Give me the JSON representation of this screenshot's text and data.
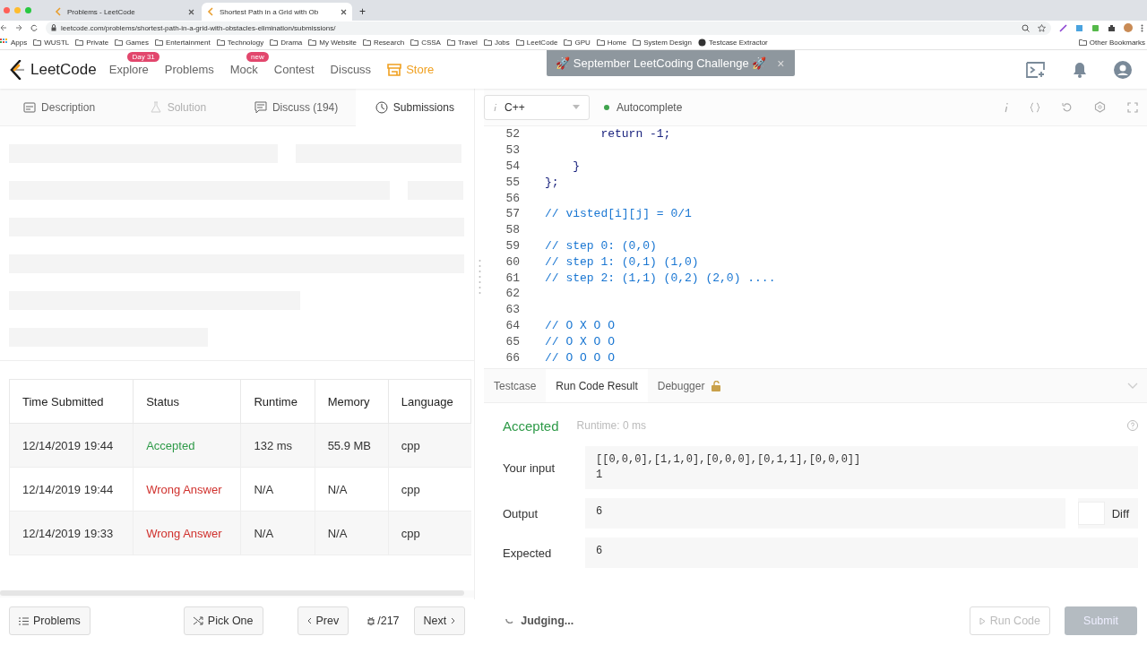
{
  "browser": {
    "tabs": [
      {
        "title": "Problems - LeetCode",
        "selected": false
      },
      {
        "title": "Shortest Path in a Grid with Ob",
        "selected": true
      }
    ],
    "new_tab": "+",
    "url": "leetcode.com/problems/shortest-path-in-a-grid-with-obstacles-elimination/submissions/",
    "bookmarks": [
      "Apps",
      "WUSTL",
      "Private",
      "Games",
      "Entertainment",
      "Technology",
      "Drama",
      "My Website",
      "Research",
      "CSSA",
      "Travel",
      "Jobs",
      "LeetCode",
      "GPU",
      "Home",
      "System Design",
      "Testcase Extractor"
    ],
    "other_bookmarks": "Other Bookmarks"
  },
  "nav": {
    "logo": "LeetCode",
    "items": [
      {
        "label": "Explore",
        "badge": "Day 31"
      },
      {
        "label": "Problems"
      },
      {
        "label": "Mock",
        "badge": "new"
      },
      {
        "label": "Contest"
      },
      {
        "label": "Discuss"
      },
      {
        "label": "Store",
        "kind": "store"
      }
    ],
    "banner": "🚀 September LeetCoding Challenge 🚀",
    "banner_close": "×"
  },
  "left_tabs": [
    {
      "label": "Description",
      "selected": false,
      "disabled": false
    },
    {
      "label": "Solution",
      "selected": false,
      "disabled": true
    },
    {
      "label": "Discuss (194)",
      "selected": false,
      "disabled": false
    },
    {
      "label": "Submissions",
      "selected": true,
      "disabled": false
    }
  ],
  "submissions": {
    "columns": [
      "Time Submitted",
      "Status",
      "Runtime",
      "Memory",
      "Language"
    ],
    "rows": [
      {
        "time": "12/14/2019 19:44",
        "status": "Accepted",
        "kind": "accepted",
        "runtime": "132 ms",
        "memory": "55.9 MB",
        "language": "cpp"
      },
      {
        "time": "12/14/2019 19:44",
        "status": "Wrong Answer",
        "kind": "wrong",
        "runtime": "N/A",
        "memory": "N/A",
        "language": "cpp"
      },
      {
        "time": "12/14/2019 19:33",
        "status": "Wrong Answer",
        "kind": "wrong",
        "runtime": "N/A",
        "memory": "N/A",
        "language": "cpp"
      }
    ]
  },
  "editor": {
    "language": "C++",
    "autocomplete": "Autocomplete",
    "lines": [
      {
        "n": "52",
        "code": "        return -1;",
        "kind": "code"
      },
      {
        "n": "53",
        "kind": "code"
      },
      {
        "n": "54",
        "code": "    }",
        "kind": "code"
      },
      {
        "n": "55",
        "code": "};",
        "kind": "code"
      },
      {
        "n": "56",
        "kind": "code"
      },
      {
        "n": "57",
        "code": "// visted[i][j] = 0/1",
        "kind": "comment"
      },
      {
        "n": "58",
        "kind": "code"
      },
      {
        "n": "59",
        "code": "// step 0: (0,0)",
        "kind": "comment"
      },
      {
        "n": "60",
        "code": "// step 1: (0,1) (1,0)",
        "kind": "comment"
      },
      {
        "n": "61",
        "code": "// step 2: (1,1) (0,2) (2,0) ....",
        "kind": "comment"
      },
      {
        "n": "62",
        "kind": "code"
      },
      {
        "n": "63",
        "kind": "code"
      },
      {
        "n": "64",
        "code": "// O X O O",
        "kind": "comment"
      },
      {
        "n": "65",
        "code": "// O X O O",
        "kind": "comment"
      },
      {
        "n": "66",
        "code": "// O O O O",
        "kind": "comment"
      }
    ]
  },
  "console": {
    "tabs": [
      {
        "label": "Testcase",
        "selected": false
      },
      {
        "label": "Run Code Result",
        "selected": true
      },
      {
        "label": "Debugger",
        "selected": false
      }
    ],
    "result": "Accepted",
    "runtime": "Runtime: 0 ms",
    "input_label": "Your input",
    "input": [
      "[[0,0,0],[1,1,0],[0,0,0],[0,1,1],[0,0,0]]",
      "1"
    ],
    "output_label": "Output",
    "output": "6",
    "diff": "Diff",
    "diff_on": false,
    "expected_label": "Expected",
    "expected": "6"
  },
  "footer": {
    "problems": "Problems",
    "pick_one": "Pick One",
    "prev": "Prev",
    "counter": "/217",
    "next": "Next",
    "judging": "Judging...",
    "run_code": "Run Code",
    "submit": "Submit"
  }
}
